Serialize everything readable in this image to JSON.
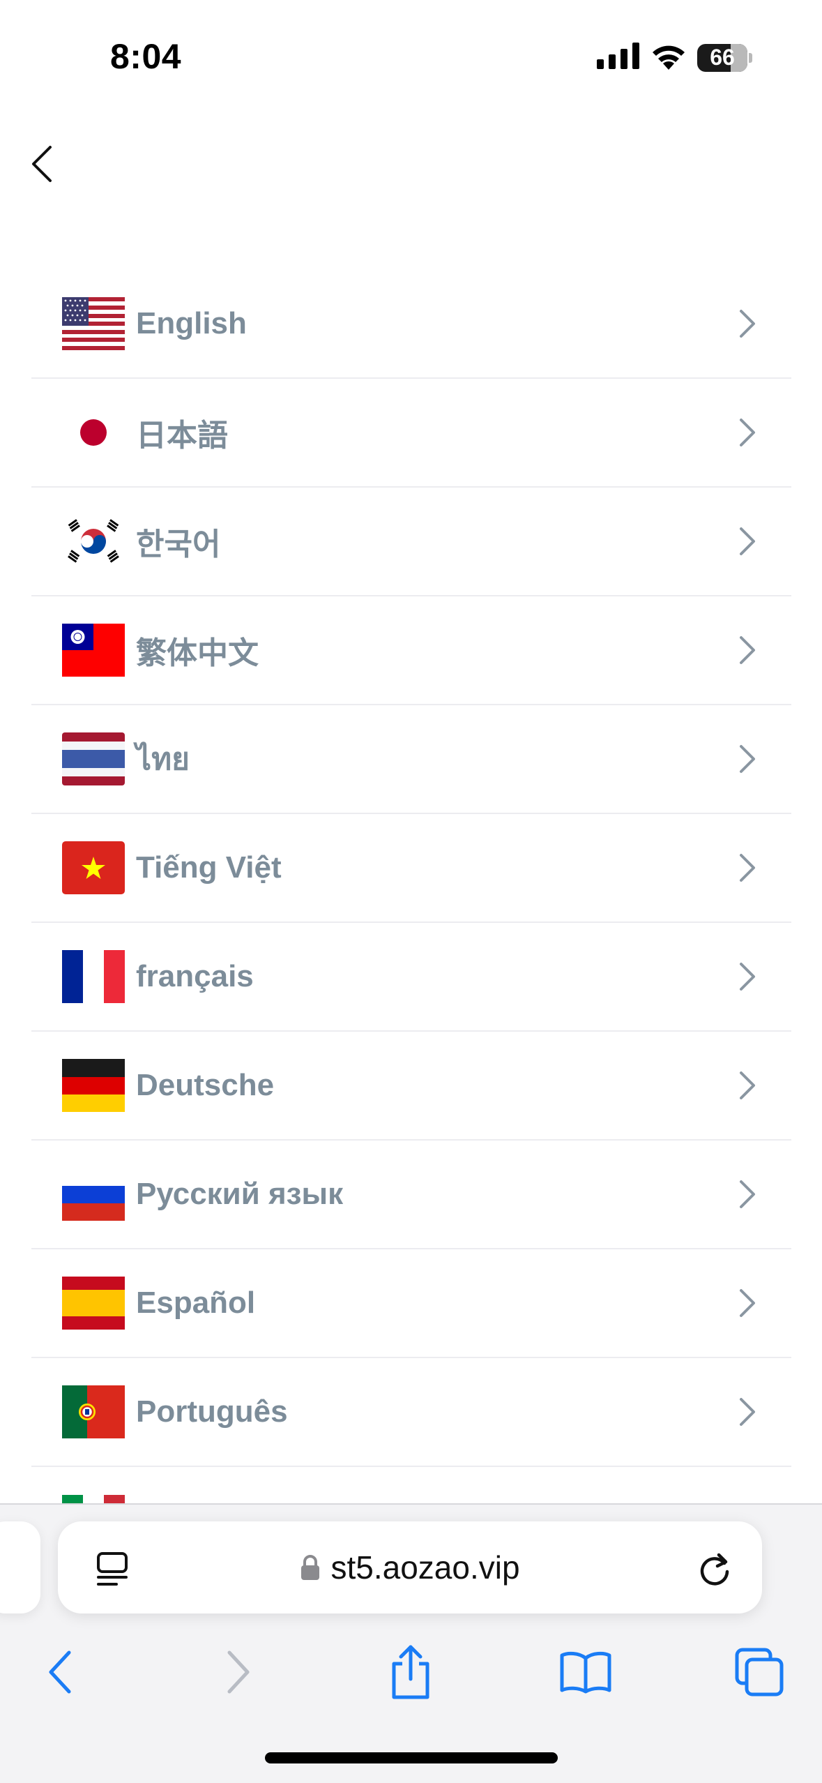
{
  "status_bar": {
    "time": "8:04",
    "battery_level": "66",
    "icons": [
      "cellular-signal-icon",
      "wifi-icon",
      "battery-icon"
    ]
  },
  "nav": {
    "back_icon": "chevron-left-icon"
  },
  "languages": [
    {
      "label": "English",
      "flag": "us-flag-icon"
    },
    {
      "label": "日本語",
      "flag": "japan-flag-icon"
    },
    {
      "label": "한국어",
      "flag": "korea-flag-icon"
    },
    {
      "label": "繁体中文",
      "flag": "taiwan-flag-icon"
    },
    {
      "label": "ไทย",
      "flag": "thailand-flag-icon"
    },
    {
      "label": "Tiếng Việt",
      "flag": "vietnam-flag-icon"
    },
    {
      "label": "français",
      "flag": "france-flag-icon"
    },
    {
      "label": "Deutsche",
      "flag": "germany-flag-icon"
    },
    {
      "label": "Русский язык",
      "flag": "russia-flag-icon"
    },
    {
      "label": "Español",
      "flag": "spain-flag-icon"
    },
    {
      "label": "Português",
      "flag": "portugal-flag-icon"
    }
  ],
  "browser": {
    "url": "st5.aozao.vip",
    "icons": [
      "reader-icon",
      "lock-icon",
      "reload-icon"
    ],
    "toolbar_icons": [
      "back-icon",
      "forward-icon",
      "share-icon",
      "bookmarks-icon",
      "tabs-icon"
    ]
  },
  "colors": {
    "label": "#7c8c99",
    "accent": "#1a7cf5",
    "disabled": "#b8bcc4",
    "divider": "#ececf0"
  }
}
